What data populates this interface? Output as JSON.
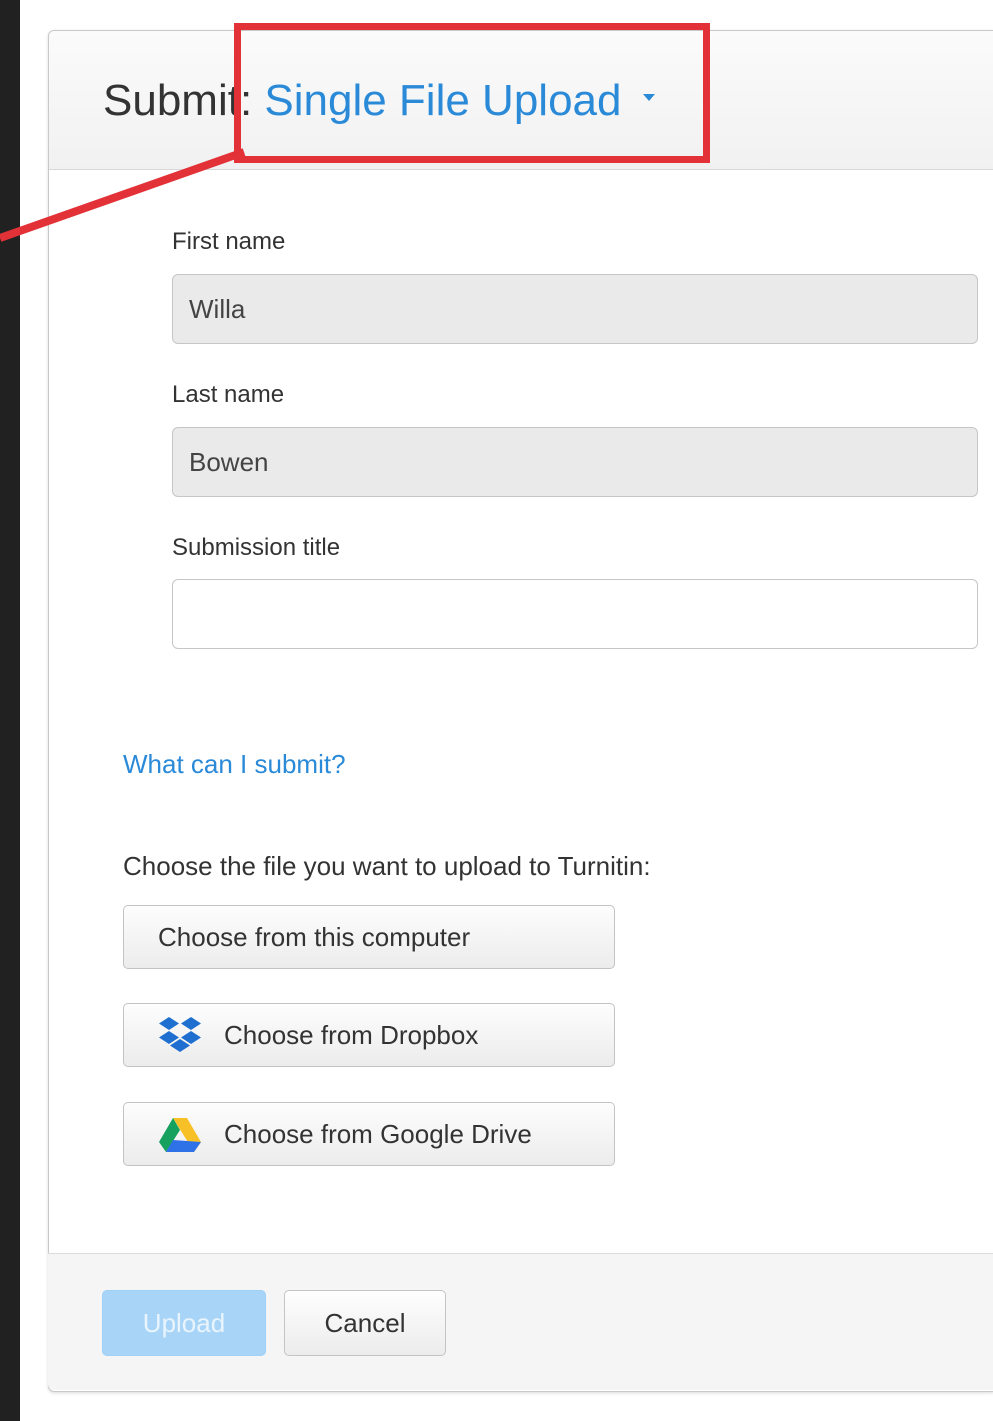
{
  "header": {
    "title_prefix": "Submit: ",
    "upload_mode": "Single File Upload"
  },
  "form": {
    "first_name": {
      "label": "First name",
      "value": "Willa"
    },
    "last_name": {
      "label": "Last name",
      "value": "Bowen"
    },
    "submission_title": {
      "label": "Submission title",
      "value": ""
    }
  },
  "help_link": "What can I submit?",
  "file_chooser": {
    "prompt": "Choose the file you want to upload to Turnitin:",
    "options": [
      {
        "label": "Choose from this computer",
        "icon": null
      },
      {
        "label": "Choose from Dropbox",
        "icon": "dropbox-icon"
      },
      {
        "label": "Choose from Google Drive",
        "icon": "google-drive-icon"
      }
    ]
  },
  "footer": {
    "upload_label": "Upload",
    "cancel_label": "Cancel"
  },
  "colors": {
    "accent_blue": "#2a8ad8",
    "annotation_red": "#e23238",
    "upload_disabled": "#a8d5f7"
  }
}
